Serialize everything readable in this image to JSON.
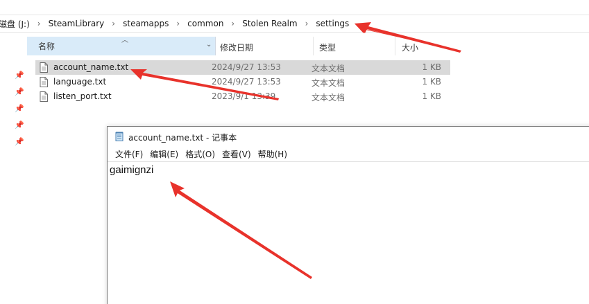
{
  "breadcrumb": {
    "items": [
      "磁盘 (J:)",
      "SteamLibrary",
      "steamapps",
      "common",
      "Stolen Realm",
      "settings"
    ]
  },
  "columns": {
    "name": "名称",
    "date": "修改日期",
    "type": "类型",
    "size": "大小"
  },
  "files": [
    {
      "name": "account_name.txt",
      "date": "2024/9/27 13:53",
      "type": "文本文档",
      "size": "1 KB"
    },
    {
      "name": "language.txt",
      "date": "2024/9/27 13:53",
      "type": "文本文档",
      "size": "1 KB"
    },
    {
      "name": "listen_port.txt",
      "date": "2023/9/1 13:39",
      "type": "文本文档",
      "size": "1 KB"
    }
  ],
  "notepad": {
    "title": "account_name.txt - 记事本",
    "menus": [
      "文件(F)",
      "编辑(E)",
      "格式(O)",
      "查看(V)",
      "帮助(H)"
    ],
    "content": "gaimignzi"
  },
  "colors": {
    "selected_row": "#d9d9d9",
    "header_highlight": "#d9ebf9",
    "arrow": "#e8322b"
  }
}
